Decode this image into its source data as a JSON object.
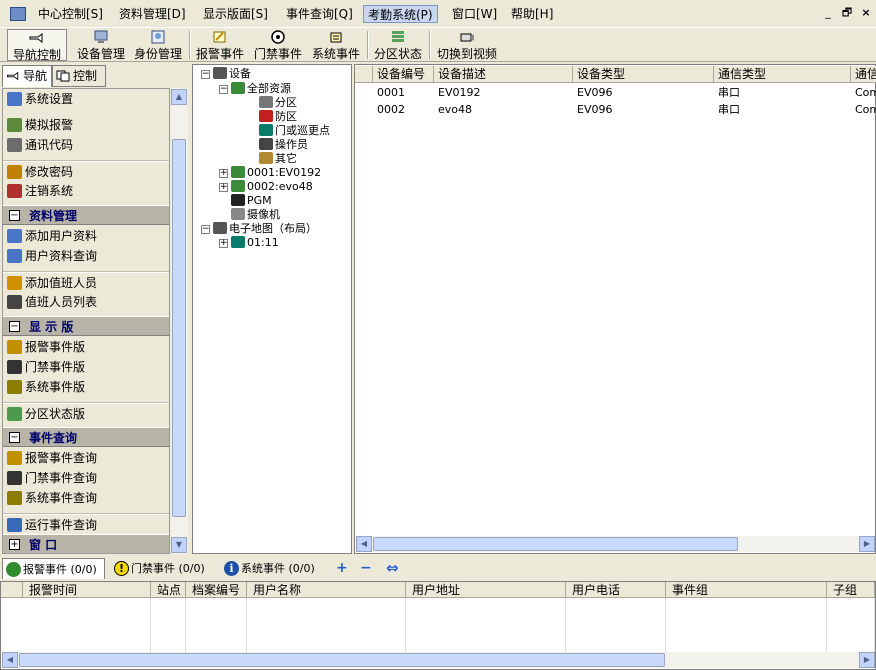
{
  "menu": {
    "items": [
      "中心控制[S]",
      "资料管理[D]",
      "显示版面[S]",
      "事件查询[Q]",
      "考勤系统(P)",
      "窗口[W]",
      "帮助[H]"
    ],
    "active_index": 4,
    "window_controls": [
      "_",
      "🗗",
      "×"
    ]
  },
  "toolbar": {
    "buttons": [
      "导航控制",
      "设备管理",
      "身份管理",
      "报警事件",
      "门禁事件",
      "系统事件",
      "分区状态",
      "切换到视频"
    ]
  },
  "left_panel": {
    "tabs": [
      "导航",
      "控制"
    ],
    "items": [
      {
        "type": "item",
        "label": "系统设置",
        "icon": "settings-icon"
      },
      {
        "type": "item",
        "label": "模拟报警",
        "icon": "alarm-sim-icon"
      },
      {
        "type": "item",
        "label": "通讯代码",
        "icon": "comm-code-icon"
      },
      {
        "type": "item",
        "label": "修改密码",
        "icon": "password-icon"
      },
      {
        "type": "item",
        "label": "注销系统",
        "icon": "logout-icon"
      },
      {
        "type": "group",
        "label": "资料管理",
        "box": "−"
      },
      {
        "type": "item",
        "label": "添加用户资料",
        "icon": "add-user-icon"
      },
      {
        "type": "item",
        "label": "用户资料查询",
        "icon": "user-query-icon"
      },
      {
        "type": "item",
        "label": "添加值班人员",
        "icon": "add-duty-icon"
      },
      {
        "type": "item",
        "label": "值班人员列表",
        "icon": "duty-list-icon"
      },
      {
        "type": "group",
        "label": "显 示 版",
        "box": "−"
      },
      {
        "type": "item",
        "label": "报警事件版",
        "icon": "alarm-board-icon"
      },
      {
        "type": "item",
        "label": "门禁事件版",
        "icon": "door-board-icon"
      },
      {
        "type": "item",
        "label": "系统事件版",
        "icon": "system-board-icon"
      },
      {
        "type": "item",
        "label": "分区状态版",
        "icon": "zone-board-icon"
      },
      {
        "type": "group",
        "label": "事件查询",
        "box": "−"
      },
      {
        "type": "item",
        "label": "报警事件查询",
        "icon": "alarm-query-icon"
      },
      {
        "type": "item",
        "label": "门禁事件查询",
        "icon": "door-query-icon"
      },
      {
        "type": "item",
        "label": "系统事件查询",
        "icon": "system-query-icon"
      },
      {
        "type": "item",
        "label": "运行事件查询",
        "icon": "run-query-icon"
      },
      {
        "type": "group",
        "label": "窗    口",
        "box": "+"
      }
    ]
  },
  "tree": {
    "nodes": [
      {
        "label": "设备",
        "level": 0,
        "expander": "−",
        "icon": "device-icon"
      },
      {
        "label": "全部资源",
        "level": 1,
        "expander": "−",
        "icon": "resources-icon"
      },
      {
        "label": "分区",
        "level": 2,
        "expander": "",
        "icon": "zone-icon"
      },
      {
        "label": "防区",
        "level": 2,
        "expander": "",
        "icon": "defense-icon"
      },
      {
        "label": "门或巡更点",
        "level": 2,
        "expander": "",
        "icon": "door-icon"
      },
      {
        "label": "操作员",
        "level": 2,
        "expander": "",
        "icon": "operator-icon"
      },
      {
        "label": "其它",
        "level": 2,
        "expander": "",
        "icon": "other-icon"
      },
      {
        "label": "0001:EV0192",
        "level": 1,
        "expander": "+",
        "icon": "panel-icon"
      },
      {
        "label": "0002:evo48",
        "level": 1,
        "expander": "+",
        "icon": "panel-icon"
      },
      {
        "label": "PGM",
        "level": 1,
        "expander": "",
        "icon": "pgm-icon"
      },
      {
        "label": "摄像机",
        "level": 1,
        "expander": "",
        "icon": "camera-icon"
      },
      {
        "label": "电子地图（布局）",
        "level": 0,
        "expander": "−",
        "icon": "map-icon"
      },
      {
        "label": "01:11",
        "level": 1,
        "expander": "+",
        "icon": "map-item-icon"
      }
    ]
  },
  "device_grid": {
    "columns": [
      "设备编号",
      "设备描述",
      "设备类型",
      "通信类型",
      "通信"
    ],
    "rows": [
      [
        "0001",
        "EV0192",
        "EV096",
        "串口",
        "Com"
      ],
      [
        "0002",
        "evo48",
        "EV096",
        "串口",
        "Com"
      ]
    ]
  },
  "bottom_tabs": [
    {
      "label": "报警事件 (0/0)",
      "icon": "alarm-event-icon",
      "color": "#2e8b2e"
    },
    {
      "label": "门禁事件 (0/0)",
      "icon": "warning-icon",
      "color": "#f5d800"
    },
    {
      "label": "系统事件 (0/0)",
      "icon": "info-icon",
      "color": "#1b4fa8"
    }
  ],
  "bottom_tools": [
    "+",
    "−",
    "⇔"
  ],
  "event_grid": {
    "columns": [
      "报警时间",
      "站点",
      "档案编号",
      "用户名称",
      "用户地址",
      "用户电话",
      "事件组",
      "子组"
    ]
  }
}
